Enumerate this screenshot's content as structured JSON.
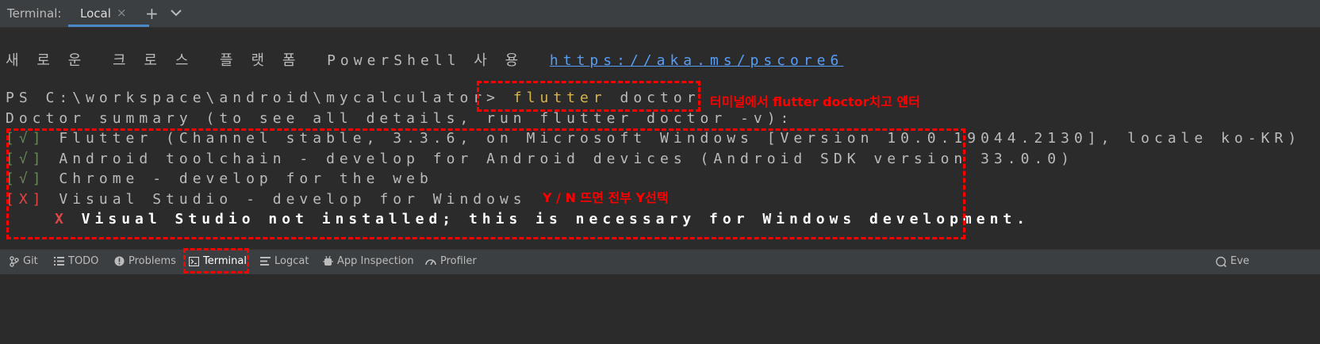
{
  "topbar": {
    "title": "Terminal:",
    "tab_label": "Local",
    "tab_close": "×",
    "new_tab": "+"
  },
  "terminal": {
    "ps_info_prefix": "새 로 운  크 로 스  플 랫 폼  PowerShell 사 용  ",
    "ps_info_link": "https://aka.ms/pscore6",
    "prompt": "PS C:\\workspace\\android\\mycalculator> ",
    "cmd_flutter": "flutter",
    "cmd_rest": " doctor",
    "summary": "Doctor summary (to see all details, run flutter doctor -v):",
    "checks": [
      {
        "mark": "[√]",
        "text": " Flutter (Channel stable, 3.3.6, on Microsoft Windows [Version 10.0.19044.2130], locale ko-KR)"
      },
      {
        "mark": "[√]",
        "text": " Android toolchain - develop for Android devices (Android SDK version 33.0.0)"
      },
      {
        "mark": "[√]",
        "text": " Chrome - develop for the web"
      },
      {
        "mark": "[X]",
        "text": " Visual Studio - develop for Windows"
      }
    ],
    "error_mark": "X",
    "error_text": " Visual Studio not installed; this is necessary for Windows development."
  },
  "annotations": {
    "enter_note": "터미널에서 flutter doctor치고 엔터",
    "yn_note": "Y / N 뜨면 전부 Y선택"
  },
  "bottombar": {
    "items": [
      "Git",
      "TODO",
      "Problems",
      "Terminal",
      "Logcat",
      "App Inspection",
      "Profiler"
    ],
    "right_label": "Eve"
  },
  "colors": {
    "background": "#2b2b2b",
    "link": "#589df6",
    "ok": "#6a8759",
    "error": "#e04646",
    "annotation": "#ff0000",
    "accent": "#4a88c7"
  }
}
